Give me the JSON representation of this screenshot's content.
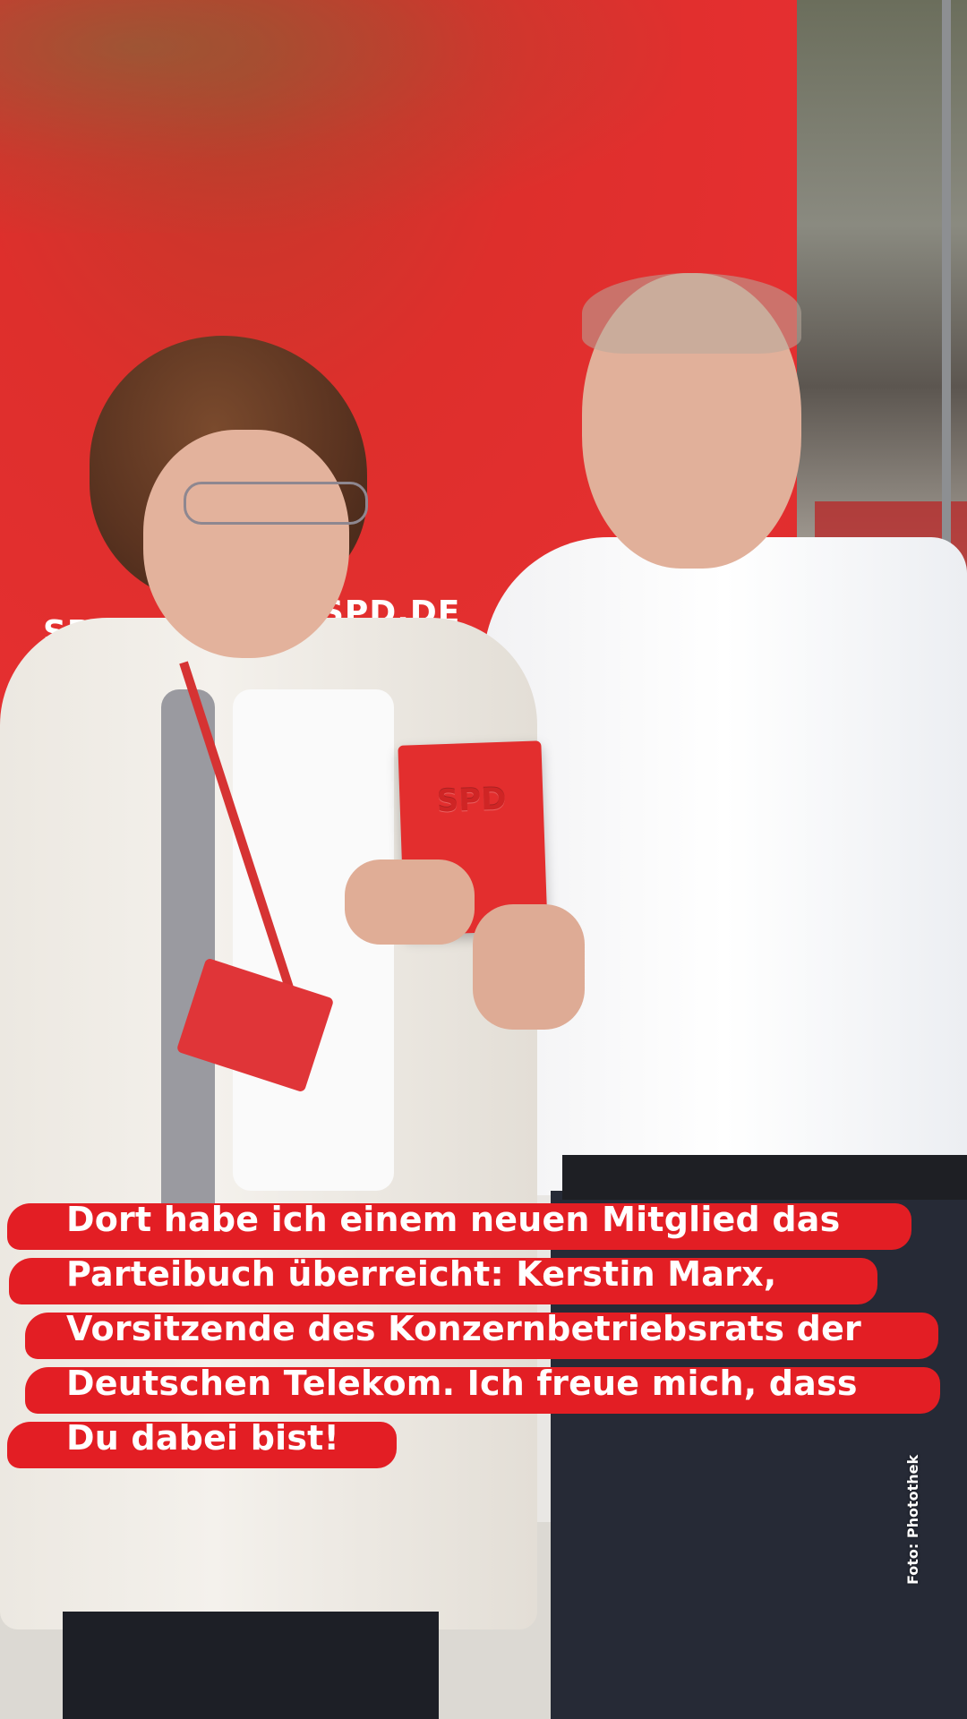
{
  "photo": {
    "backdrop_color": "#e52f30",
    "backdrop_logos": [
      "SPD",
      "SPD.DE",
      "SP"
    ],
    "book_label": "SPD",
    "credit": "Foto: Photothek"
  },
  "caption": {
    "highlight_color": "#e31e24",
    "lines": [
      "Dort habe ich einem neuen Mitglied das",
      "Parteibuch überreicht: Kerstin Marx,",
      "Vorsitzende des Konzernbetriebsrats der",
      "Deutschen Telekom. Ich freue mich, dass",
      "Du dabei bist!"
    ]
  }
}
